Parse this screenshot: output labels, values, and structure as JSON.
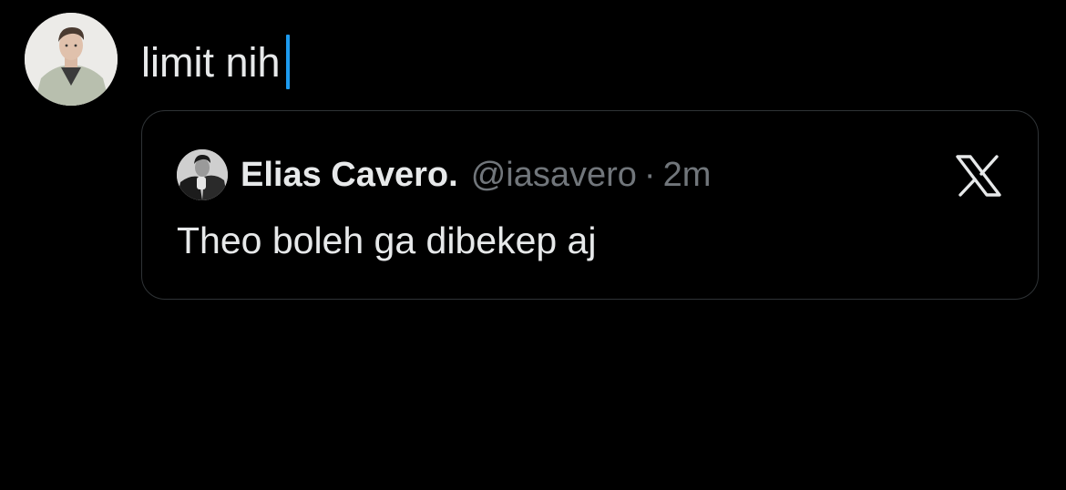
{
  "compose": {
    "text": "limit nih",
    "avatar_icon": "user-avatar-photo",
    "caret_color": "#1d9bf0"
  },
  "quoted_post": {
    "avatar_icon": "quoted-user-avatar-photo",
    "display_name": "Elias Cavero.",
    "handle": "@iasavero",
    "separator": "·",
    "timestamp": "2m",
    "body": "Theo boleh ga dibekep aj",
    "platform_icon": "x-logo-icon"
  },
  "colors": {
    "background": "#000000",
    "text": "#e7e9ea",
    "secondary_text": "#71767b",
    "border": "#2f3336"
  }
}
